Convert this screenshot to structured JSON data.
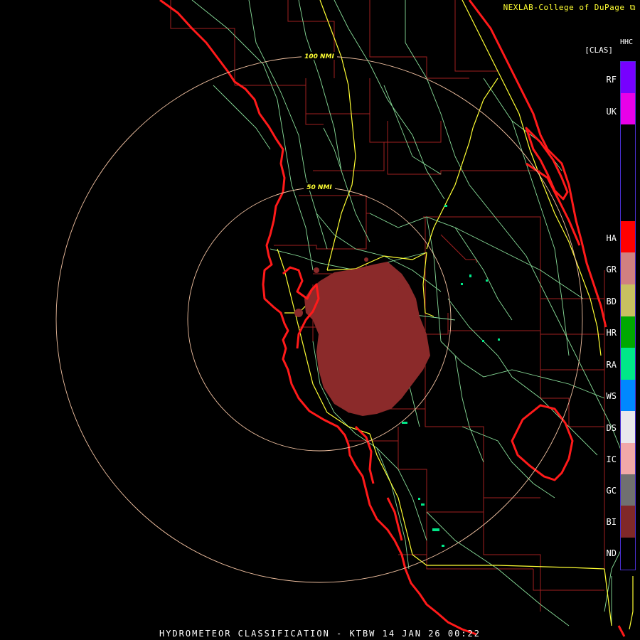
{
  "credit": "NEXLAB-College of DuPage",
  "title": "HYDROMETEOR CLASSIFICATION - KTBW 14 JAN 26 00:22",
  "legend": {
    "code": "HHC",
    "label": "[CLAS]",
    "classes": [
      {
        "label": "RF",
        "color": "#7700ff"
      },
      {
        "label": "UK",
        "color": "#e800e8"
      },
      {
        "label": "HA",
        "color": "#ff0000"
      },
      {
        "label": "GR",
        "color": "#d08080"
      },
      {
        "label": "BD",
        "color": "#c8c060"
      },
      {
        "label": "HR",
        "color": "#00a800"
      },
      {
        "label": "RA",
        "color": "#00e888"
      },
      {
        "label": "WS",
        "color": "#0088ff"
      },
      {
        "label": "DS",
        "color": "#e8e8ec"
      },
      {
        "label": "IC",
        "color": "#f0a8a8"
      },
      {
        "label": "GC",
        "color": "#707070"
      },
      {
        "label": "BI",
        "color": "#802828"
      },
      {
        "label": "ND",
        "color": "#000000"
      }
    ]
  },
  "range_rings": [
    {
      "label": "50 NMI"
    },
    {
      "label": "100 NMI"
    }
  ],
  "colors": {
    "coastline": "#ff1a1a",
    "county_lines": "#a02020",
    "roads_minor": "#88dd99",
    "roads_major": "#ffff33",
    "range_rings": "#f0c0a0",
    "echo": "#8b2a2a"
  }
}
